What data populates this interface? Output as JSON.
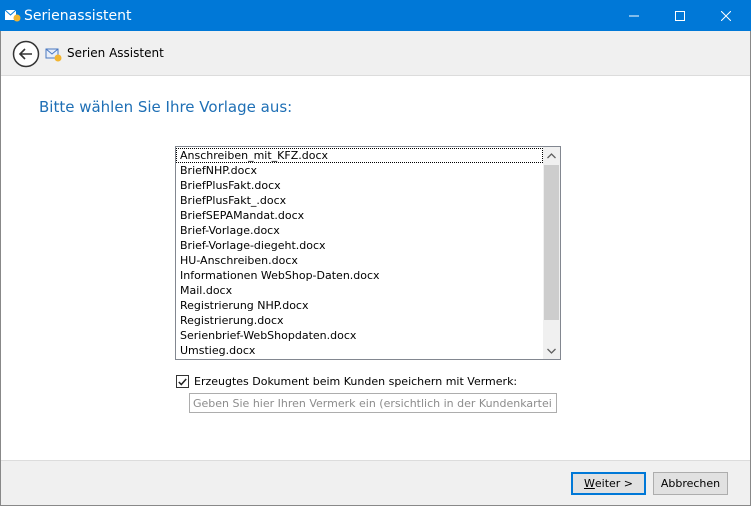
{
  "window": {
    "title": "Serienassistent",
    "accent": "#0078d7"
  },
  "toolbar": {
    "label": "Serien Assistent"
  },
  "main": {
    "heading": "Bitte wählen Sie Ihre Vorlage aus:",
    "templates": [
      "Anschreiben_mit_KFZ.docx",
      "BriefNHP.docx",
      "BriefPlusFakt.docx",
      "BriefPlusFakt_.docx",
      "BriefSEPAMandat.docx",
      "Brief-Vorlage.docx",
      "Brief-Vorlage-diegeht.docx",
      "HU-Anschreiben.docx",
      "Informationen WebShop-Daten.docx",
      "Mail.docx",
      "Registrierung NHP.docx",
      "Registrierung.docx",
      "Serienbrief-WebShopdaten.docx",
      "Umstieg.docx"
    ],
    "selected_index": 0,
    "save_checkbox": {
      "label": "Erzeugtes Dokument beim Kunden speichern mit Vermerk:",
      "checked": true
    },
    "remark": {
      "value": "",
      "placeholder": "Geben Sie hier Ihren Vermerk ein (ersichtlich in der Kundenkartei)"
    }
  },
  "footer": {
    "next_label": "Weiter >",
    "cancel_label": "Abbrechen"
  }
}
